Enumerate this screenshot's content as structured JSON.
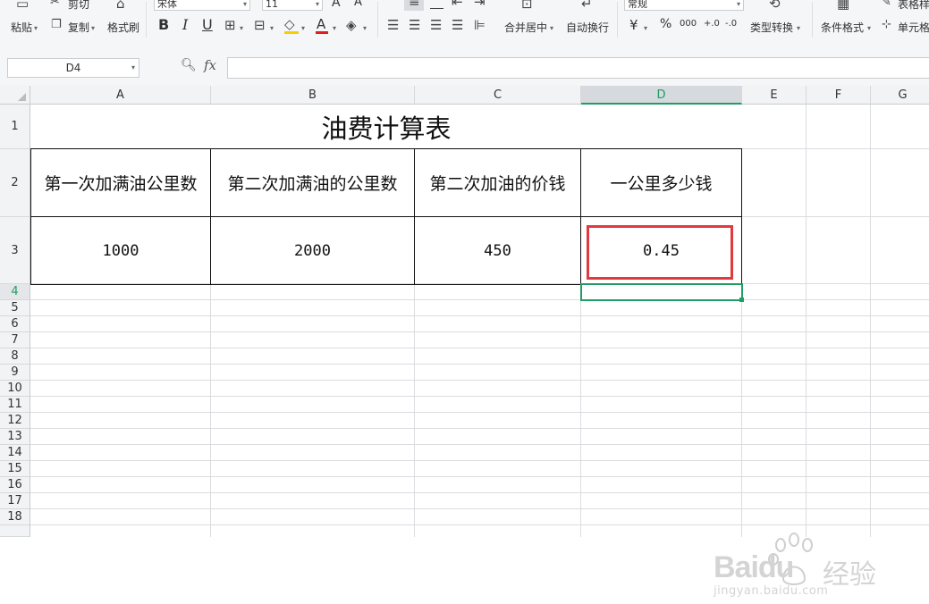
{
  "ribbon": {
    "paste_label": "粘贴",
    "cut_label": "剪切",
    "copy_label": "复制",
    "format_painter_label": "格式刷",
    "font_name": "宋体",
    "font_size": "11",
    "font_increase_label": "A",
    "font_decrease_label": "A",
    "bold_label": "B",
    "italic_label": "I",
    "underline_label": "U",
    "merge_center_label": "合并居中",
    "wrap_text_label": "自动换行",
    "number_format": "常规",
    "currency_label": "¥",
    "percent_label": "%",
    "thousands_label": "000",
    "increase_decimal_label": "+.0",
    "decrease_decimal_label": "-.0",
    "type_convert_label": "类型转换",
    "conditional_format_label": "条件格式",
    "table_style_label": "表格样",
    "cell_label": "单元格"
  },
  "formula_bar": {
    "name_box": "D4",
    "fx_label": "fx",
    "formula": ""
  },
  "columns": [
    "A",
    "B",
    "C",
    "D",
    "E",
    "F",
    "G"
  ],
  "rows": [
    "1",
    "2",
    "3",
    "4",
    "5",
    "6",
    "7",
    "8",
    "9",
    "10",
    "11",
    "12",
    "13",
    "14",
    "15",
    "16",
    "17",
    "18"
  ],
  "selected_cell": "D4",
  "sheet": {
    "title": "油费计算表",
    "headers": [
      "第一次加满油公里数",
      "第二次加满油的公里数",
      "第二次加油的价钱",
      "一公里多少钱"
    ],
    "values": [
      "1000",
      "2000",
      "450",
      "0.45"
    ]
  },
  "watermark": {
    "brand": "Baidu",
    "brand_cn": "经验",
    "url": "jingyan.baidu.com"
  },
  "colors": {
    "selection": "#1f9d64",
    "highlight_box": "#e0393e"
  }
}
